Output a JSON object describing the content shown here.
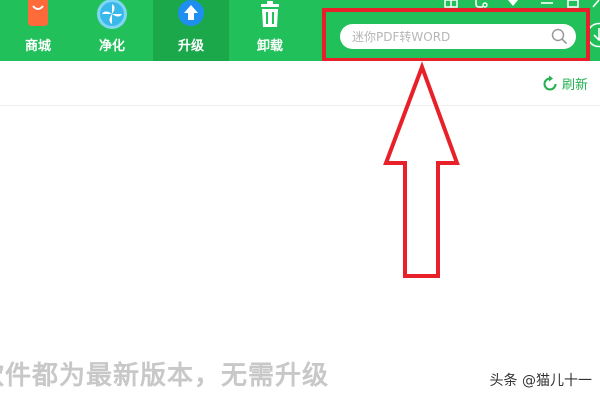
{
  "nav": {
    "tabs": [
      {
        "label": "商城",
        "icon": "bag-icon"
      },
      {
        "label": "净化",
        "icon": "fan-icon"
      },
      {
        "label": "升级",
        "icon": "upload-arrow-icon"
      },
      {
        "label": "卸载",
        "icon": "trash-icon"
      }
    ],
    "active_tab": "升级"
  },
  "search": {
    "placeholder": "迷你PDF转WORD",
    "value": ""
  },
  "toolbar": {
    "refresh_label": "刷新"
  },
  "main": {
    "status_message": "软件都为最新版本，无需升级"
  },
  "watermark": {
    "text": "头条 @猫儿十一"
  },
  "colors": {
    "brand_green": "#22c05a",
    "highlight_red": "#e8202a",
    "status_gray": "#c8c8c8"
  }
}
